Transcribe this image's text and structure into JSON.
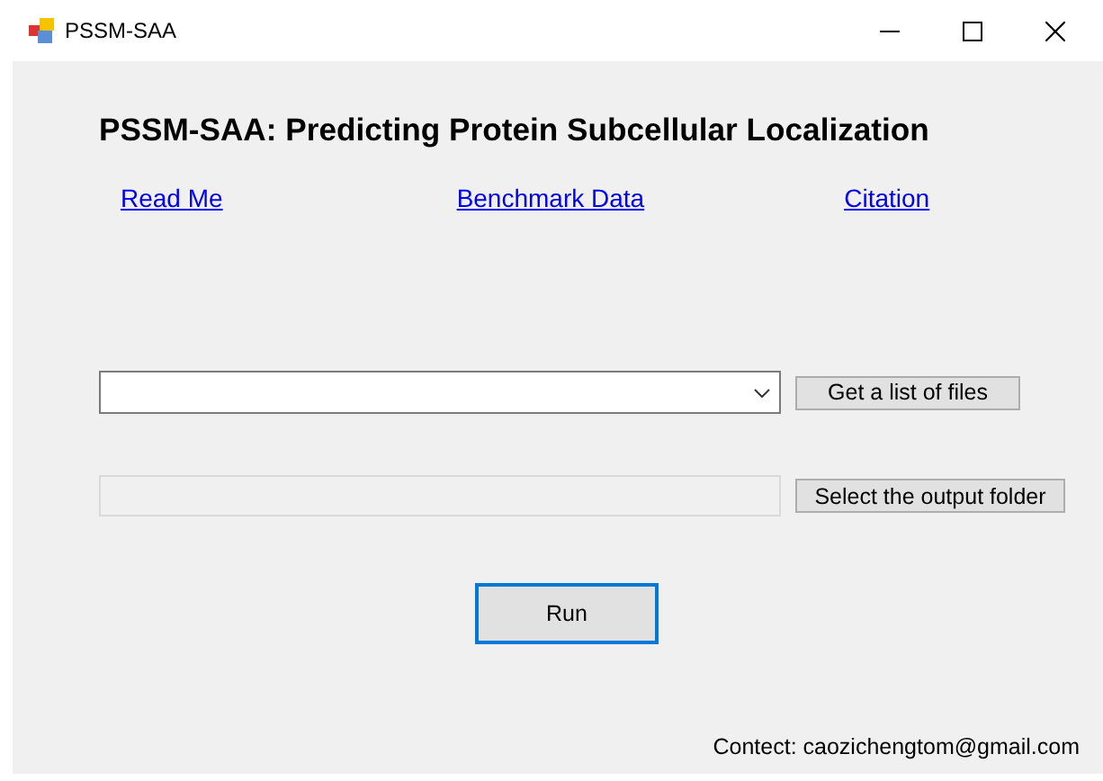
{
  "window": {
    "title": "PSSM-SAA"
  },
  "heading": "PSSM-SAA: Predicting Protein Subcellular Localization",
  "links": [
    {
      "label": "Read Me"
    },
    {
      "label": "Benchmark Data"
    },
    {
      "label": "Citation"
    }
  ],
  "file_list": {
    "button": "Get a list of files"
  },
  "output_folder": {
    "disabled": true,
    "button": "Select the output folder"
  },
  "run_button": {
    "label": "Run",
    "focused": true
  },
  "contact": "Contect: caozichengtom@gmail.com"
}
